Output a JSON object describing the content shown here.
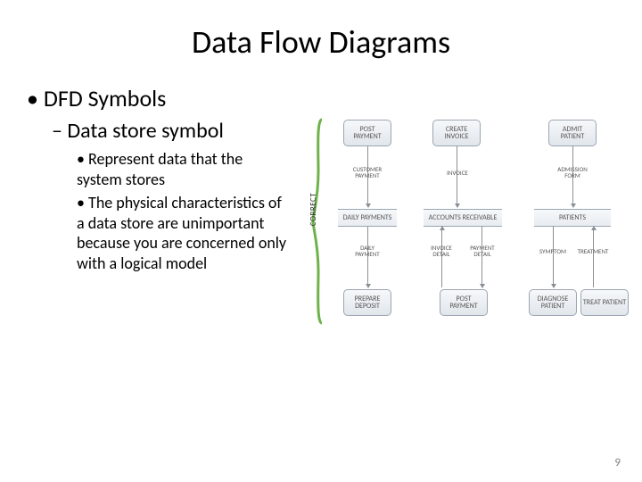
{
  "title": "Data Flow Diagrams",
  "bullets": {
    "lvl1": "DFD Symbols",
    "lvl2": "Data store symbol",
    "lvl3a": "Represent data that the system stores",
    "lvl3b": "The physical characteristics of a data store are unimportant because you are concerned only with a logical model"
  },
  "page_number": "9",
  "diagram": {
    "side_label": "CORRECT",
    "processes": {
      "post_payment_top": "POST PAYMENT",
      "create_invoice": "CREATE INVOICE",
      "admit_patient": "ADMIT PATIENT",
      "prepare_deposit": "PREPARE DEPOSIT",
      "post_payment_bot": "POST PAYMENT",
      "diagnose_patient": "DIAGNOSE PATIENT",
      "treat_patient": "TREAT PATIENT"
    },
    "stores": {
      "daily_payments": "DAILY PAYMENTS",
      "accounts_receivable": "ACCOUNTS RECEIVABLE",
      "patients": "PATIENTS"
    },
    "flows": {
      "customer_payment": "CUSTOMER PAYMENT",
      "invoice": "INVOICE",
      "admission_form": "ADMISSION FORM",
      "daily_payment": "DAILY PAYMENT",
      "invoice_detail": "INVOICE DETAIL",
      "payment_detail": "PAYMENT DETAIL",
      "symptom": "SYMPTOM",
      "treatment": "TREATMENT"
    }
  }
}
